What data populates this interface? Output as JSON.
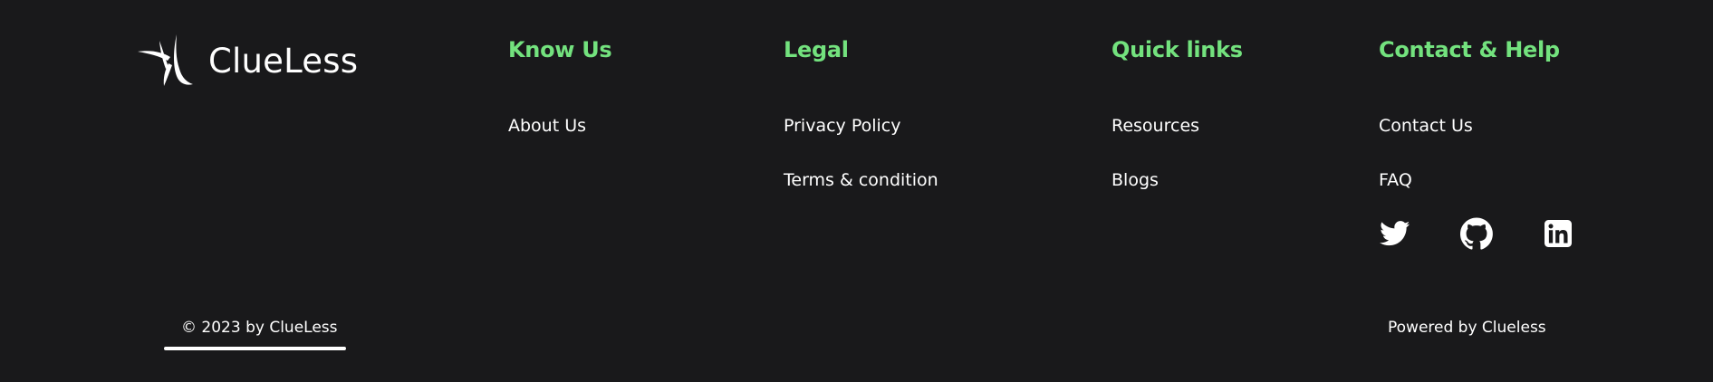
{
  "brand": {
    "name": "ClueLess",
    "logo_icon": "dragonfly-logo-icon"
  },
  "accent_color": "#73e27e",
  "background_color": "#19191b",
  "columns": [
    {
      "title": "Know Us",
      "links": [
        "About Us"
      ]
    },
    {
      "title": "Legal",
      "links": [
        "Privacy Policy",
        "Terms & condition"
      ]
    },
    {
      "title": "Quick links",
      "links": [
        "Resources",
        "Blogs"
      ]
    },
    {
      "title": "Contact & Help",
      "links": [
        "Contact Us",
        "FAQ"
      ]
    }
  ],
  "socials": [
    {
      "icon": "twitter-icon"
    },
    {
      "icon": "github-icon"
    },
    {
      "icon": "linkedin-icon"
    }
  ],
  "bottom": {
    "copyright": "© 2023 by ClueLess",
    "powered_by": "Powered by Clueless"
  }
}
